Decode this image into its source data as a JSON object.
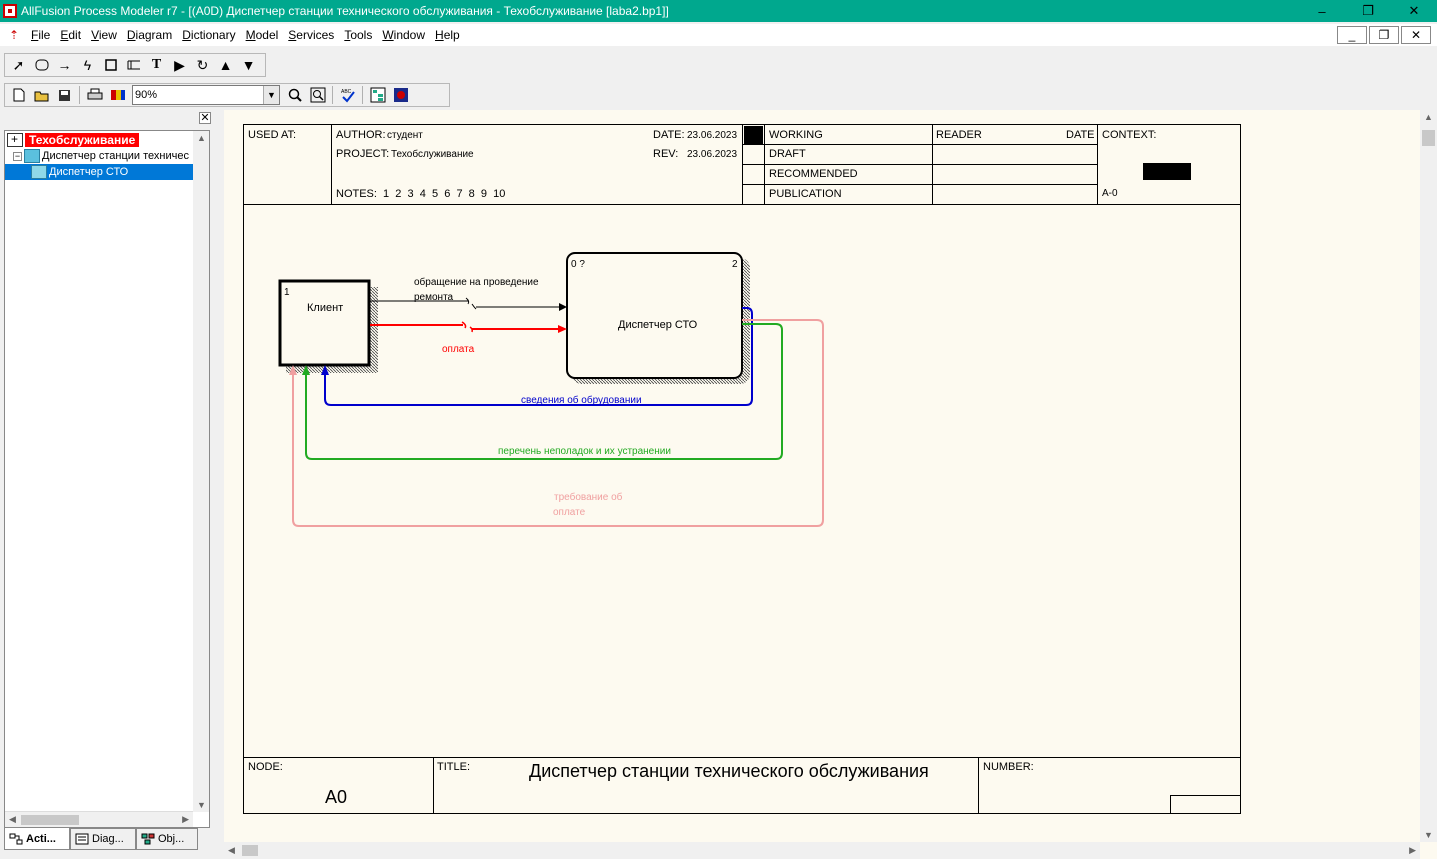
{
  "window": {
    "title": "AllFusion Process Modeler r7 - [(A0D) Диспетчер станции технического обслуживания - Техобслуживание  [laba2.bp1]]",
    "minimize": "–",
    "maximize": "❐",
    "close": "✕"
  },
  "menu": {
    "items": [
      "File",
      "Edit",
      "View",
      "Diagram",
      "Dictionary",
      "Model",
      "Services",
      "Tools",
      "Window",
      "Help"
    ],
    "mdi_minimize": "_",
    "mdi_restore": "❐",
    "mdi_close": "✕"
  },
  "toolbar": {
    "zoom_value": "90%"
  },
  "explorer": {
    "model_name": "Техобслуживание",
    "diagram_name": "Диспетчер станции техничес",
    "activity_name": "Диспетчер СТО",
    "tabs": [
      "Acti...",
      "Diag...",
      "Obj..."
    ]
  },
  "header": {
    "used_at": "USED AT:",
    "author_label": "AUTHOR:",
    "author": "студент",
    "project_label": "PROJECT:",
    "project": "Техобслуживание",
    "date_label": "DATE:",
    "date": "23.06.2023",
    "rev_label": "REV:",
    "rev": "23.06.2023",
    "notes": "NOTES:  1  2  3  4  5  6  7  8  9  10",
    "working": "WORKING",
    "draft": "DRAFT",
    "recommended": "RECOMMENDED",
    "publication": "PUBLICATION",
    "reader": "READER",
    "reader_date": "DATE",
    "context": "CONTEXT:",
    "context_node": "A-0"
  },
  "footer": {
    "node_label": "NODE:",
    "node": "A0",
    "title_label": "TITLE:",
    "title": "Диспетчер станции технического обслуживания",
    "number_label": "NUMBER:"
  },
  "diagram": {
    "box1": {
      "number": "1",
      "label": "Клиент"
    },
    "box2": {
      "prefix": "0 ?",
      "number": "2",
      "label": "Диспетчер СТО"
    },
    "arrows": {
      "request_line1": "обращение на проведение",
      "request_line2": "ремонта",
      "payment": "оплата",
      "equipment_info": "сведения об обрудовании",
      "defects": "перечень неполадок и их устранении",
      "payment_req_line1": "требование об",
      "payment_req_line2": "оплате"
    },
    "colors": {
      "black": "#000000",
      "red": "#ff0000",
      "blue": "#0000cc",
      "green": "#22aa22",
      "pink": "#f0a0a0"
    }
  }
}
